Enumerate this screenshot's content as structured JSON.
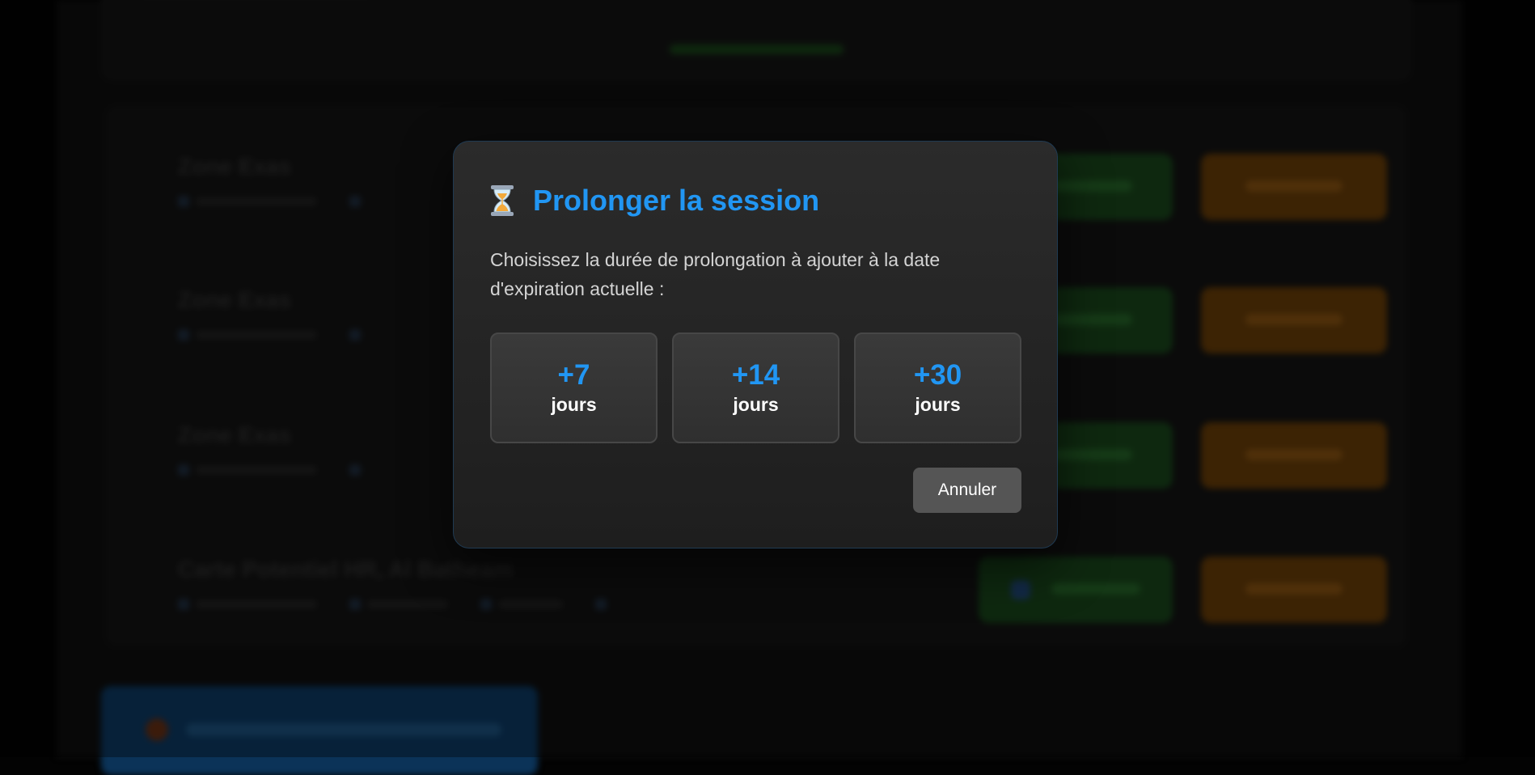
{
  "modal": {
    "icon": "hourglass-icon",
    "title": "Prolonger la session",
    "description": "Choisissez la durée de prolongation à ajouter à la date d'expiration actuelle :",
    "options": [
      {
        "value": "+7",
        "unit": "jours"
      },
      {
        "value": "+14",
        "unit": "jours"
      },
      {
        "value": "+30",
        "unit": "jours"
      }
    ],
    "cancel_label": "Annuler"
  },
  "background": {
    "rows": [
      {
        "title": "Zone Exas"
      },
      {
        "title": "Zone Exas"
      },
      {
        "title": "Zone Exas"
      },
      {
        "title": "Carte Potentiel HR, Al Batheam"
      }
    ]
  },
  "colors": {
    "accent": "#2196f3",
    "modal_border": "#1f3a52",
    "cancel_bg": "#555555"
  }
}
